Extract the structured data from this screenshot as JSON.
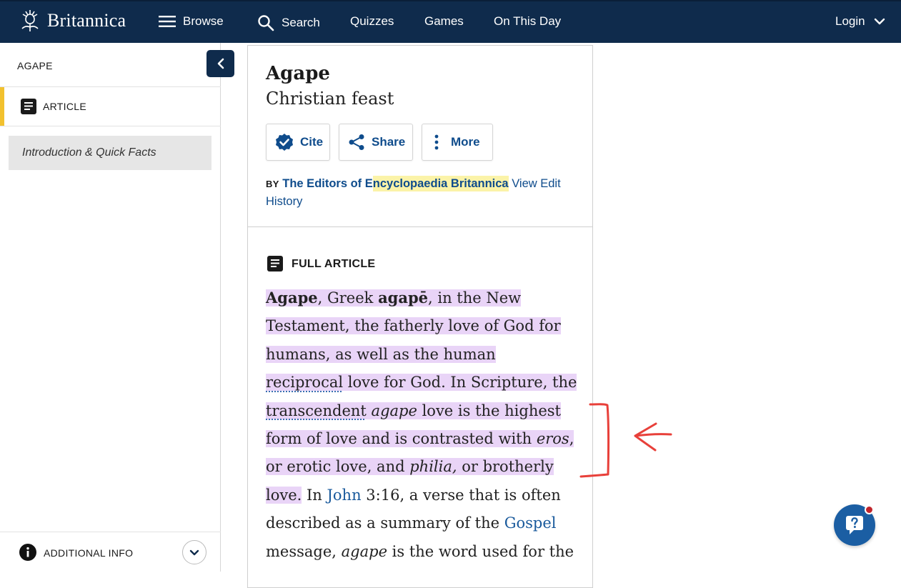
{
  "header": {
    "brand": "Britannica",
    "nav": [
      {
        "label": "Browse",
        "icon": "menu-icon"
      },
      {
        "label": "Search",
        "icon": "search-icon"
      },
      {
        "label": "Quizzes"
      },
      {
        "label": "Games"
      },
      {
        "label": "On This Day"
      }
    ],
    "login": "Login"
  },
  "sidebar": {
    "title": "AGAPE",
    "article_label": "ARTICLE",
    "intro_item": "Introduction & Quick Facts",
    "additional_info": "ADDITIONAL INFO"
  },
  "article": {
    "title": "Agape",
    "subtitle": "Christian feast",
    "buttons": {
      "cite": "Cite",
      "share": "Share",
      "more": "More"
    },
    "byline": {
      "by": "BY",
      "author_part1": "The Editors of E",
      "author_part2": "ncyclopaedia Britannica",
      "view_edit": " View Edit",
      "history": "History"
    },
    "full_article_label": "FULL ARTICLE",
    "body": {
      "l1_b": "Agape",
      "l1_a": ", Greek ",
      "l1_b2": "agapē",
      "l1_c": ", in the New",
      "l2": "Testament, the fatherly love of God for",
      "l3": "humans, as well as the human",
      "l4_dotted": "reciprocal",
      "l4_rest": " love for God. In Scripture, the",
      "l5_dotted": "transcendent",
      "l5_a": " ",
      "l5_i": "agape",
      "l5_b": " love is the highest",
      "l6_a": "form of love and is contrasted with ",
      "l6_i": "eros",
      "l6_b": ",",
      "l7_a": "or erotic love, and ",
      "l7_i": "philia,",
      "l7_b": " or brotherly",
      "l8_hl": "love.",
      "l8_a": " In ",
      "l8_link": "John",
      "l8_b": " 3:16, a verse that is often",
      "l9_a": "described as a summary of the ",
      "l9_link": "Gospel",
      "l10_a": "message, ",
      "l10_i": "agape",
      "l10_b": " is the word used for the"
    }
  },
  "colors": {
    "nav_bg": "#0f2b4c",
    "link": "#0f4c8c",
    "highlight_yellow": "#fbf3a8",
    "highlight_purple": "#e9d4f7",
    "accent_yellow": "#f2c12e",
    "annotation_red": "#e8403a"
  }
}
